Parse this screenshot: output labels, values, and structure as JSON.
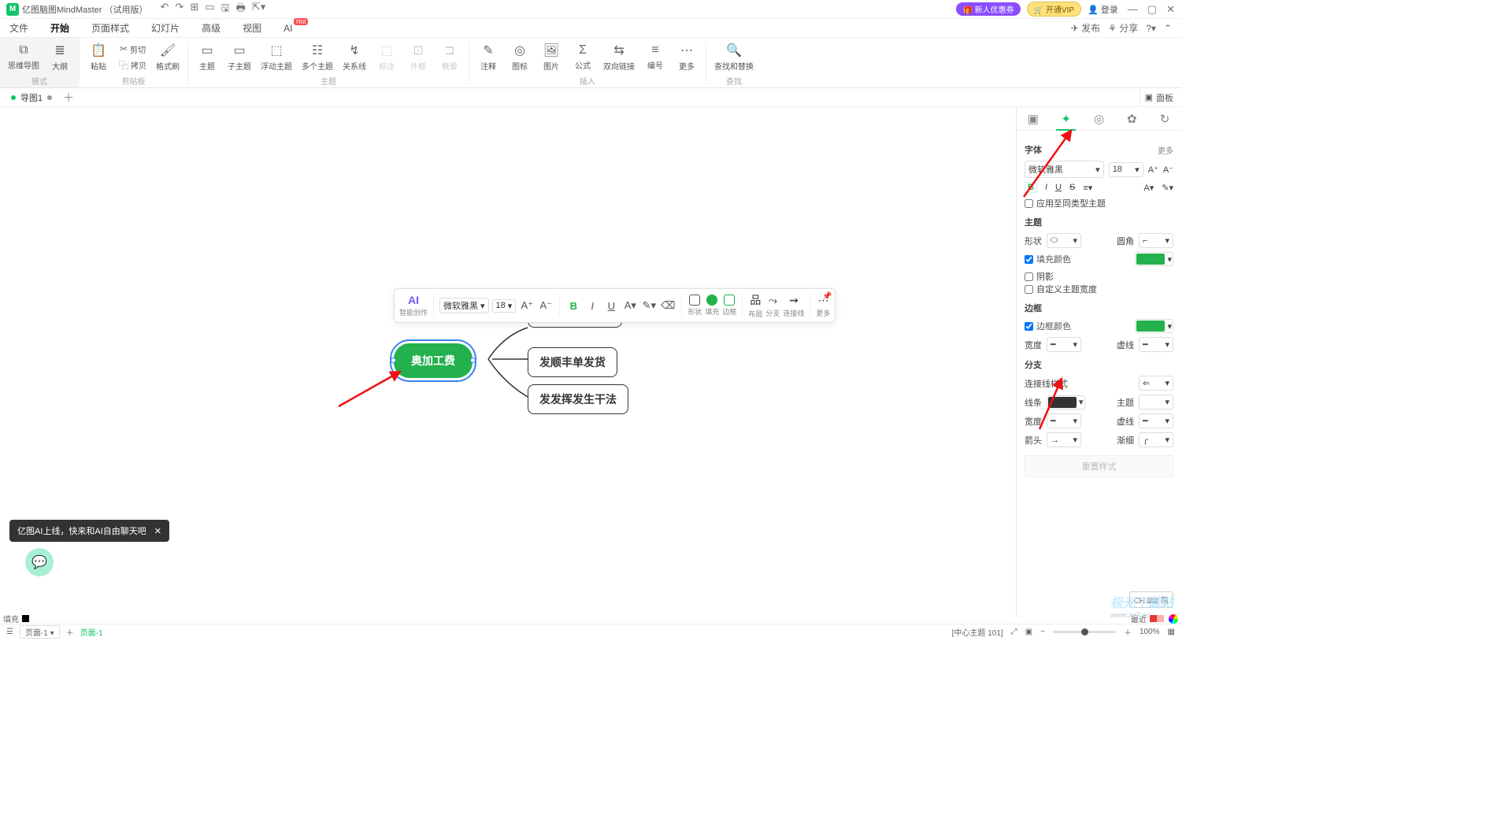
{
  "title": "亿图脑图MindMaster （试用版）",
  "titlebar": {
    "new_user": "🎁 新人优惠券",
    "vip": "🛒 开通VIP",
    "login": "登录"
  },
  "menu": {
    "tabs": [
      "文件",
      "开始",
      "页面样式",
      "幻灯片",
      "高级",
      "视图",
      "AI"
    ],
    "active_index": 1,
    "hot": "Hot",
    "publish": "发布",
    "share": "分享"
  },
  "ribbon": {
    "group_mode": "模式",
    "mindmap": "思维导图",
    "outline": "大纲",
    "group_clip": "剪贴板",
    "paste": "粘贴",
    "cut": "剪切",
    "copy": "拷贝",
    "format": "格式刷",
    "group_topic": "主题",
    "topic": "主题",
    "subtopic": "子主题",
    "float": "浮动主题",
    "multi": "多个主题",
    "relation": "关系线",
    "callout": "标注",
    "boundary": "外框",
    "summary": "概要",
    "group_insert": "插入",
    "note": "注释",
    "icon": "图标",
    "image": "图片",
    "formula": "公式",
    "hyperlink": "双向链接",
    "number": "编号",
    "more": "更多",
    "group_find": "查找",
    "findreplace": "查找和替换"
  },
  "doctab": {
    "name": "导图1",
    "panel": "面板"
  },
  "floatbar": {
    "ai": "AI",
    "ai_label": "智能创作",
    "font": "微软雅黑",
    "size": "18",
    "shape": "形状",
    "fill": "填充",
    "border": "边框",
    "layout": "布局",
    "branch": "分支",
    "connect": "连接线",
    "more": "更多"
  },
  "nodes": {
    "main": "奥加工费",
    "child1": "发顺丰单发货",
    "child2": "发发挥发生干法"
  },
  "panel": {
    "font_section": "字体",
    "more": "更多",
    "font_name": "微软雅黑",
    "font_size": "18",
    "apply_same": "应用至同类型主题",
    "topic_section": "主题",
    "shape": "形状",
    "corner": "圆角",
    "fill_color": "填充颜色",
    "shadow": "阴影",
    "custom_width": "自定义主题宽度",
    "border_section": "边框",
    "border_color": "边框颜色",
    "width": "宽度",
    "dash": "虚线",
    "branch_section": "分支",
    "line_style": "连接线样式",
    "line": "线条",
    "topic_link": "主题",
    "width2": "宽度",
    "dash2": "虚线",
    "arrow": "箭头",
    "taper": "渐细",
    "reset": "重置样式",
    "green": "#22b14c",
    "black": "#333333"
  },
  "toast": {
    "text": "亿图AI上线，快来和AI自由聊天吧"
  },
  "ime": "CH ⌨ 简",
  "colorbar": {
    "fill": "填充",
    "recent": "最近"
  },
  "status": {
    "page_sel": "页面-1",
    "page_lbl": "页面-1",
    "info": "[中心主题 101]",
    "zoom": "100%"
  },
  "watermark": {
    "big": "极光下载站",
    "small": "www.xz7.cc"
  }
}
